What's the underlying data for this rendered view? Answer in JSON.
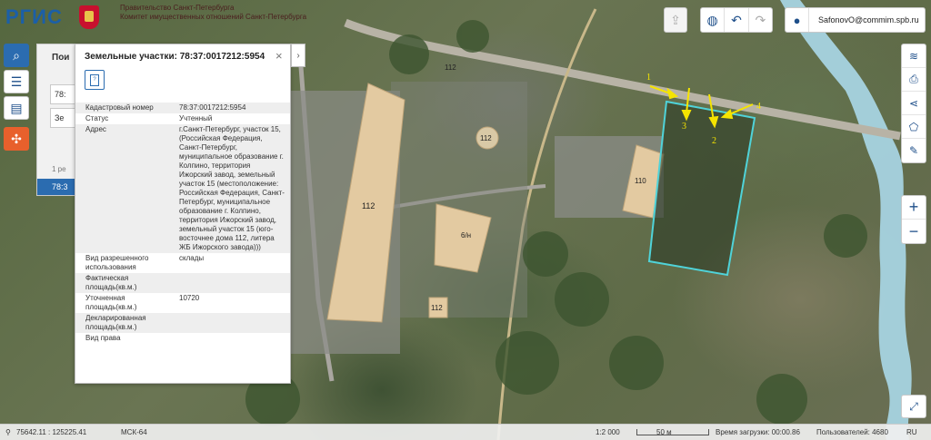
{
  "header": {
    "logo_text": "РГИС",
    "sub_line1": "Правительство Санкт-Петербурга",
    "sub_line2": "Комитет имущественных отношений Санкт-Петербурга",
    "user": "SafonovO@commim.spb.ru"
  },
  "search_panel": {
    "title": "Пои",
    "field1": "78:",
    "field2": "Зе",
    "note": "1 ре",
    "result": "78:3"
  },
  "popup": {
    "title": "Земельные участки: 78:37:0017212:5954",
    "close": "×",
    "collapse": "›",
    "doc_icon": "?",
    "rows": [
      {
        "label": "Кадастровый номер",
        "value": "78:37:0017212:5954"
      },
      {
        "label": "Статус",
        "value": "Учтенный"
      },
      {
        "label": "Адрес",
        "value": "г.Санкт-Петербург, участок 15, (Российская Федерация, Санкт-Петербург, муниципальное образование г. Колпино, территория Ижорский завод, земельный участок 15 (местоположение: Российская Федерация, Санкт-Петербург, муниципальное образование г. Колпино, территория Ижорский завод, земельный участок 15 (юго-восточнее дома 112, литера ЖБ Ижорского завода)))"
      },
      {
        "label": "Вид разрешенного использования",
        "value": "склады"
      },
      {
        "label": "Фактическая площадь(кв.м.)",
        "value": ""
      },
      {
        "label": "Уточненная площадь(кв.м.)",
        "value": "10720"
      },
      {
        "label": "Декларированная площадь(кв.м.)",
        "value": ""
      },
      {
        "label": "Вид права",
        "value": ""
      }
    ]
  },
  "map": {
    "building_labels": [
      "112",
      "112",
      "112",
      "6/н",
      "112",
      "110"
    ],
    "arrow_labels": [
      "1",
      "2",
      "3",
      "4"
    ],
    "parcel_color": "#4fd3d9",
    "arrow_color": "#f5e400"
  },
  "status": {
    "coords": "75642.11 : 125225.41",
    "crs": "МСК-64",
    "scale": "1:2 000",
    "scale_bar": "50 м",
    "load_time": "Время загрузки: 00:00.86",
    "users": "Пользователей: 4680",
    "lang": "RU"
  },
  "icons": {
    "left_bar": [
      "search-icon",
      "menu-icon",
      "user-card-icon",
      "tool-icon"
    ],
    "right_bar": [
      "layers-icon",
      "print-icon",
      "share-icon",
      "ruler-shape-icon",
      "pencil-icon"
    ],
    "top": [
      "export-icon",
      "globe-icon",
      "undo-icon",
      "redo-icon",
      "user-icon"
    ]
  }
}
